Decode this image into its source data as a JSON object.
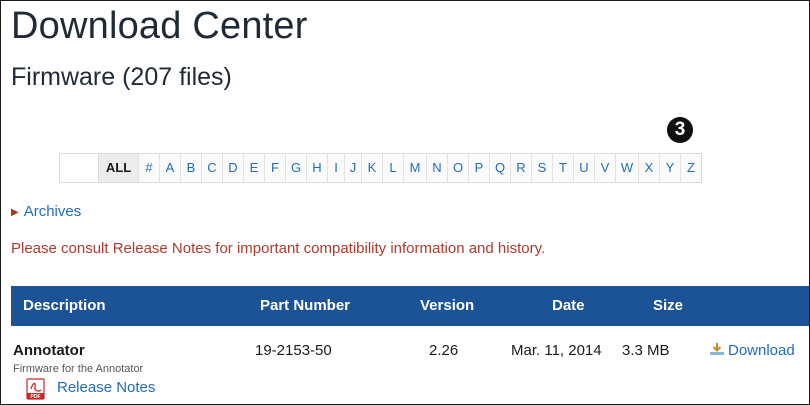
{
  "page": {
    "title": "Download Center",
    "subtitle": "Firmware (207 files)",
    "callout": "3"
  },
  "alpha": [
    "ALL",
    "#",
    "A",
    "B",
    "C",
    "D",
    "E",
    "F",
    "G",
    "H",
    "I",
    "J",
    "K",
    "L",
    "M",
    "N",
    "O",
    "P",
    "Q",
    "R",
    "S",
    "T",
    "U",
    "V",
    "W",
    "X",
    "Y",
    "Z"
  ],
  "archives_label": "Archives",
  "notice": "Please consult Release Notes for important compatibility information and history.",
  "table": {
    "headers": [
      "Description",
      "Part Number",
      "Version",
      "Date",
      "Size"
    ],
    "rows": [
      {
        "name": "Annotator",
        "description": "Firmware for the Annotator",
        "release_notes": "Release Notes",
        "part_number": "19-2153-50",
        "version": "2.26",
        "date": "Mar. 11, 2014",
        "size": "3.3 MB",
        "download": "Download"
      }
    ]
  },
  "colors": {
    "header_bg": "#1c5296",
    "link": "#1f6bbf",
    "notice": "#b03a2e"
  }
}
